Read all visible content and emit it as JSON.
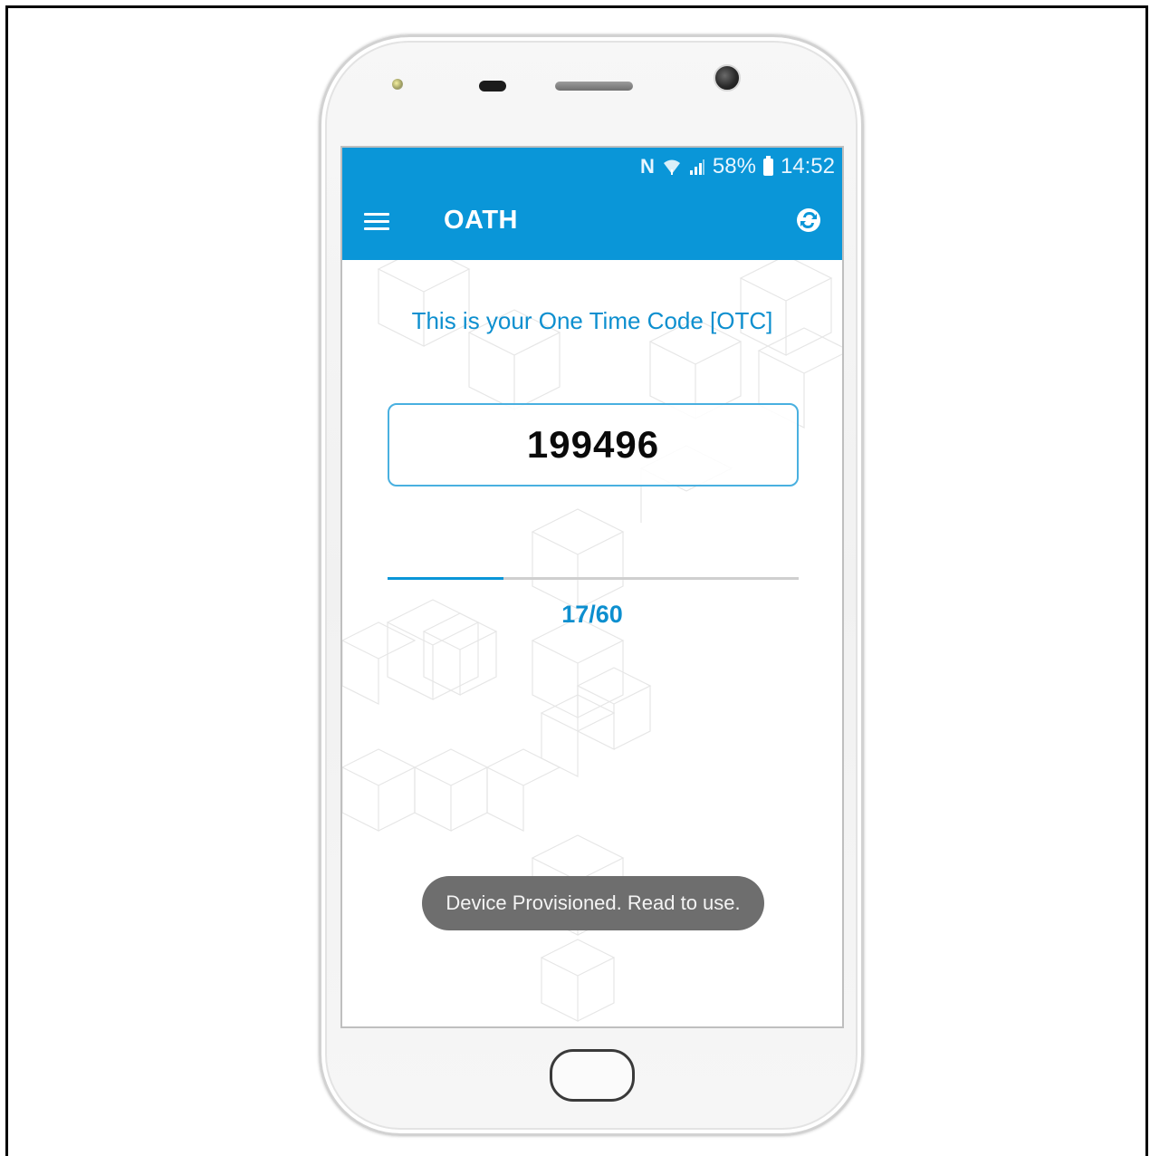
{
  "status_bar": {
    "nfc_label": "N",
    "battery_text": "58%",
    "time": "14:52"
  },
  "app_bar": {
    "title": "OATH",
    "menu_icon": "hamburger-menu-icon",
    "sync_icon": "sync-icon",
    "background_color": "#0a96d8"
  },
  "otc": {
    "heading": "This is your One Time Code [OTC]",
    "code": "199496"
  },
  "timer": {
    "label": "17/60",
    "elapsed": 17,
    "total": 60,
    "progress_fraction": 0.283
  },
  "toast": {
    "message": "Device Provisioned. Read to use."
  },
  "colors": {
    "accent": "#0a96d8",
    "heading": "#0d8fcf",
    "toast_bg": "#6e6e6e"
  }
}
